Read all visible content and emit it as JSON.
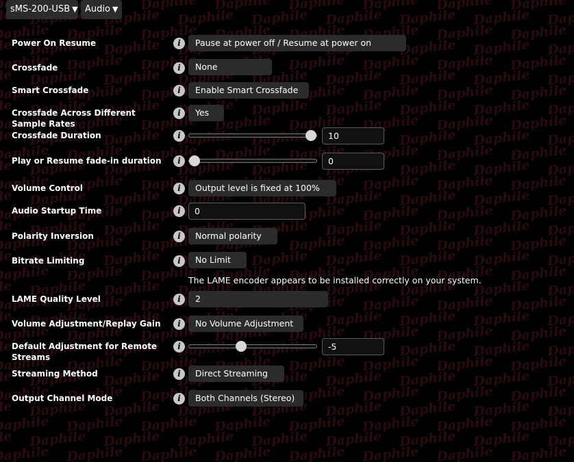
{
  "header": {
    "device_label": "sMS-200-USB",
    "section_label": "Audio"
  },
  "watermark": {
    "text": "Daphile",
    "color": "#2a0b10"
  },
  "icons": {
    "caret": "caret-down-icon",
    "info": "info-icon"
  },
  "settings": {
    "power_on_resume": {
      "label": "Power On Resume",
      "value": "Pause at power off / Resume at power on"
    },
    "crossfade": {
      "label": "Crossfade",
      "value": "None"
    },
    "smart_crossfade": {
      "label": "Smart Crossfade",
      "value": "Enable Smart Crossfade"
    },
    "crossfade_sample_rates": {
      "label": "Crossfade Across Different Sample Rates",
      "value": "Yes"
    },
    "crossfade_duration": {
      "label": "Crossfade Duration",
      "value": "10",
      "slider_fraction": 1.0
    },
    "fade_in_duration": {
      "label": "Play or Resume fade-in duration",
      "value": "0",
      "slider_fraction": 0.0
    },
    "volume_control": {
      "label": "Volume Control",
      "value": "Output level is fixed at 100%"
    },
    "audio_startup_time": {
      "label": "Audio Startup Time",
      "value": "0"
    },
    "polarity_inversion": {
      "label": "Polarity Inversion",
      "value": "Normal polarity"
    },
    "bitrate_limiting": {
      "label": "Bitrate Limiting",
      "value": "No Limit"
    },
    "lame_note": "The LAME encoder appears to be installed correctly on your system.",
    "lame_quality": {
      "label": "LAME Quality Level",
      "value": "2"
    },
    "volume_adjustment": {
      "label": "Volume Adjustment/Replay Gain",
      "value": "No Volume Adjustment"
    },
    "remote_streams_adjustment": {
      "label": "Default Adjustment for Remote Streams",
      "value": "-5",
      "slider_fraction": 0.4
    },
    "streaming_method": {
      "label": "Streaming Method",
      "value": "Direct Streaming"
    },
    "output_channel_mode": {
      "label": "Output Channel Mode",
      "value": "Both Channels (Stereo)"
    }
  }
}
